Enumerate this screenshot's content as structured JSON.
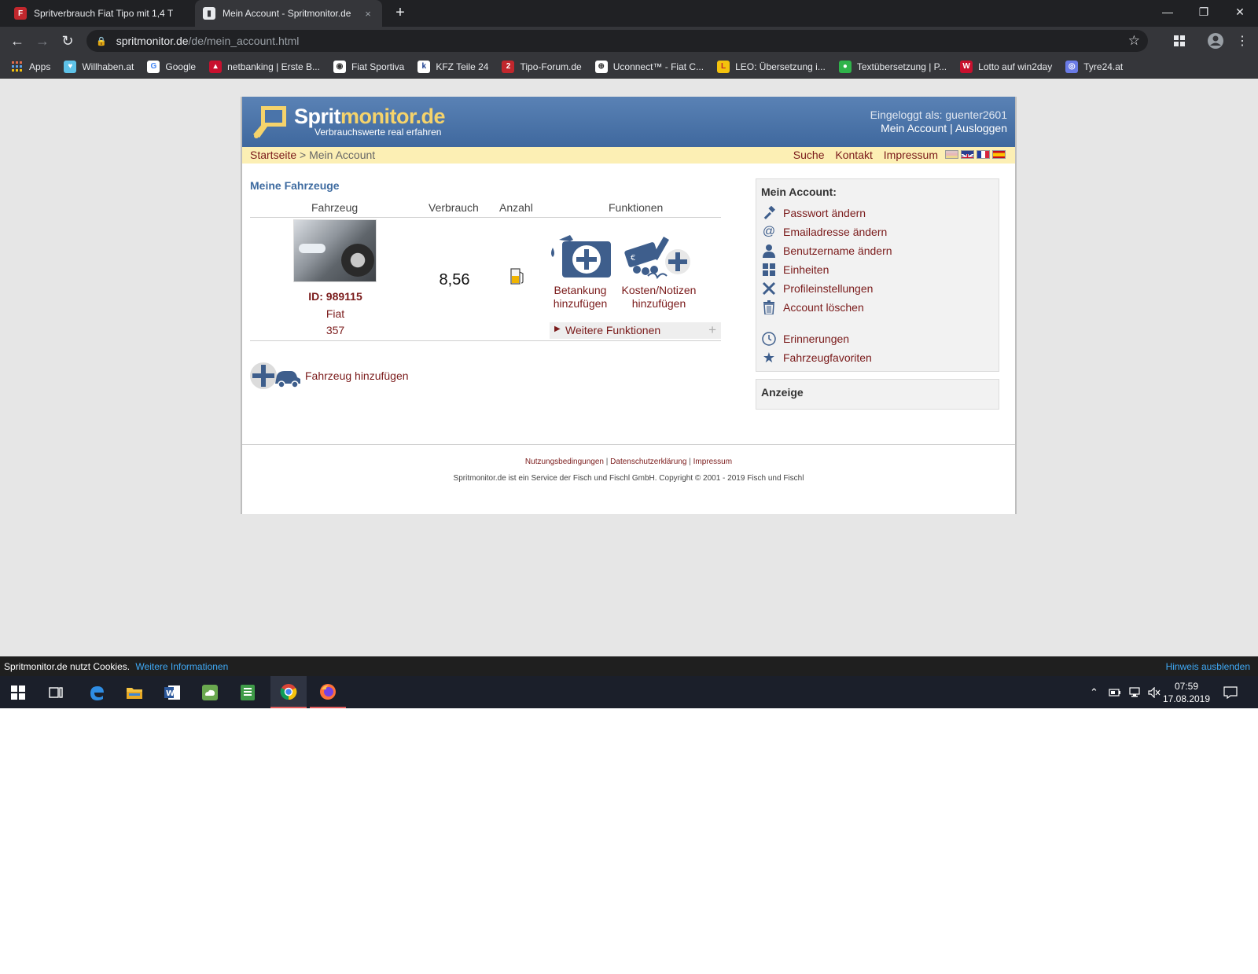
{
  "browser": {
    "tabs": [
      {
        "title": "Spritverbrauch Fiat Tipo mit 1,4 T"
      },
      {
        "title": "Mein Account - Spritmonitor.de",
        "close": "×"
      }
    ],
    "new_tab": "+",
    "window": {
      "minimize": "—",
      "restore": "❐",
      "close": "✕"
    },
    "url_host": "spritmonitor.de",
    "url_path": "/de/mein_account.html",
    "bookmarks": [
      {
        "label": "Apps",
        "icon": "apps-grid-icon"
      },
      {
        "label": "Willhaben.at",
        "icon": "willhaben-icon"
      },
      {
        "label": "Google",
        "icon": "google-icon"
      },
      {
        "label": "netbanking | Erste B...",
        "icon": "bank-icon"
      },
      {
        "label": "Fiat Sportiva",
        "icon": "fiat-icon"
      },
      {
        "label": "KFZ Teile 24",
        "icon": "kfz-icon"
      },
      {
        "label": "Tipo-Forum.de",
        "icon": "forum-icon"
      },
      {
        "label": "Uconnect™ - Fiat C...",
        "icon": "uconnect-icon"
      },
      {
        "label": "LEO: Übersetzung i...",
        "icon": "leo-icon"
      },
      {
        "label": "Textübersetzung | P...",
        "icon": "translate-icon"
      },
      {
        "label": "Lotto auf win2day",
        "icon": "lotto-icon"
      },
      {
        "label": "Tyre24.at",
        "icon": "tyre-icon"
      }
    ]
  },
  "site": {
    "logo_left": "Sprit",
    "logo_right": "monitor.de",
    "tagline": "Verbrauchswerte real erfahren",
    "logged_in": "Eingeloggt als: guenter2601",
    "my_account": "Mein Account",
    "sep": "|",
    "logout": "Ausloggen",
    "crumb_home": "Startseite",
    "crumb_sep": ">",
    "crumb_current": "Mein Account",
    "nav": {
      "search": "Suche",
      "contact": "Kontakt",
      "imprint": "Impressum"
    },
    "flags": [
      "de-flag-icon",
      "uk-flag-icon",
      "fr-flag-icon",
      "es-flag-icon"
    ]
  },
  "vehicles": {
    "title": "Meine Fahrzeuge",
    "columns": {
      "vehicle": "Fahrzeug",
      "consumption": "Verbrauch",
      "count": "Anzahl",
      "functions": "Funktionen"
    },
    "rows": [
      {
        "id": "ID: 989115",
        "make": "Fiat",
        "model": "357",
        "consumption": "8,56",
        "count_icon": "fuel-pump-icon"
      }
    ],
    "actions": {
      "refuel_line1": "Betankung",
      "refuel_line2": "hinzufügen",
      "costs_line1": "Kosten/Notizen",
      "costs_line2": "hinzufügen",
      "more": "Weitere Funktionen"
    },
    "add_vehicle": "Fahrzeug hinzufügen"
  },
  "sidebar": {
    "title": "Mein Account:",
    "items": [
      {
        "label": "Passwort ändern",
        "icon": "hammer-icon"
      },
      {
        "label": "Emailadresse ändern",
        "icon": "at-icon"
      },
      {
        "label": "Benutzername ändern",
        "icon": "user-icon"
      },
      {
        "label": "Einheiten",
        "icon": "grid-icon"
      },
      {
        "label": "Profileinstellungen",
        "icon": "tools-icon"
      },
      {
        "label": "Account löschen",
        "icon": "trash-icon"
      },
      {
        "label": "Erinnerungen",
        "icon": "clock-icon"
      },
      {
        "label": "Fahrzeugfavoriten",
        "icon": "star-icon"
      }
    ],
    "ad_title": "Anzeige"
  },
  "footer": {
    "terms": "Nutzungsbedingungen",
    "privacy": "Datenschutzerklärung",
    "imprint": "Impressum",
    "sep": "|",
    "copyright": "Spritmonitor.de ist ein Service der Fisch und Fischl GmbH. Copyright © 2001 - 2019 Fisch und Fischl"
  },
  "cookie_bar": {
    "message": "Spritmonitor.de nutzt Cookies.",
    "more": "Weitere Informationen",
    "hide": "Hinweis ausblenden"
  },
  "taskbar": {
    "time": "07:59",
    "date": "17.08.2019",
    "apps": [
      "windows-start-icon",
      "task-view-icon",
      "edge-icon",
      "file-explorer-icon",
      "word-icon",
      "cloud-app-icon",
      "notes-app-icon",
      "chrome-icon",
      "firefox-icon"
    ]
  },
  "colors": {
    "header_blue": "#4a74aa",
    "crumb_bar": "#fcefb4",
    "link_red": "#7a1a1a",
    "title_blue": "#3e6ba0"
  }
}
